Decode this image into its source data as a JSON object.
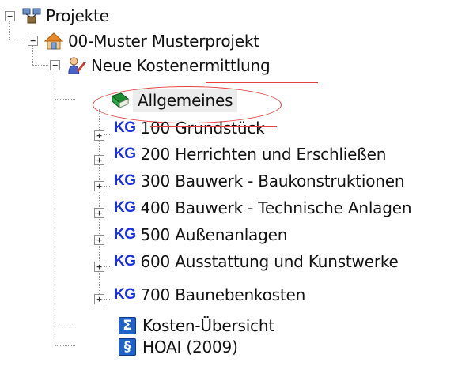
{
  "tree": {
    "root": {
      "label": "Projekte",
      "icon": "network-projects-icon"
    },
    "project": {
      "label": "00-Muster Musterprojekt",
      "icon": "house-icon"
    },
    "estimate": {
      "label": "Neue Kostenermittlung",
      "icon": "person-edit-icon"
    },
    "general": {
      "label": "Allgemeines",
      "icon": "book-icon"
    },
    "kg_prefix": "KG",
    "groups": [
      {
        "code": "100",
        "label": "100 Grundstück"
      },
      {
        "code": "200",
        "label": "200 Herrichten und Erschließen"
      },
      {
        "code": "300",
        "label": "300 Bauwerk - Baukonstruktionen"
      },
      {
        "code": "400",
        "label": "400 Bauwerk - Technische Anlagen"
      },
      {
        "code": "500",
        "label": "500 Außenanlagen"
      },
      {
        "code": "600",
        "label": "600 Ausstattung und Kunstwerke"
      },
      {
        "code": "700",
        "label": "700 Baunebenkosten"
      }
    ],
    "overview": {
      "label": "Kosten-Übersicht",
      "icon_glyph": "Σ",
      "icon": "sigma-icon"
    },
    "hoai": {
      "label": "HOAI (2009)",
      "icon_glyph": "§",
      "icon": "paragraph-icon"
    }
  },
  "colors": {
    "kg": "#1a2fe0",
    "annotation": "#e44040",
    "box_icon": "#1f62c8"
  }
}
